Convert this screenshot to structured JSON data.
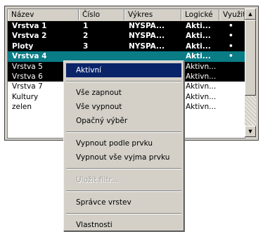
{
  "columns": [
    "Název",
    "Číslo",
    "Výkres",
    "Logické",
    "Využito"
  ],
  "rows": [
    {
      "name": "Vrstva 1",
      "num": "1",
      "draw": "NYSPA...",
      "log": "Akti...",
      "use": "•",
      "state": "sel",
      "bold": true
    },
    {
      "name": "Vrstva 2",
      "num": "2",
      "draw": "NYSPA...",
      "log": "Akti...",
      "use": "•",
      "state": "sel",
      "bold": true
    },
    {
      "name": "Ploty",
      "num": "3",
      "draw": "NYSPA...",
      "log": "Akti...",
      "use": "•",
      "state": "sel",
      "bold": true
    },
    {
      "name": "Vrstva 4",
      "num": "",
      "draw": "",
      "log": "Akti...",
      "use": "•",
      "state": "focus",
      "bold": true
    },
    {
      "name": "Vrstva 5",
      "num": "",
      "draw": "",
      "log": "Aktivn...",
      "use": "",
      "state": "dark",
      "bold": false
    },
    {
      "name": "Vrstva 6",
      "num": "",
      "draw": "",
      "log": "Aktivn...",
      "use": "",
      "state": "dark",
      "bold": false
    },
    {
      "name": "Vrstva 7",
      "num": "",
      "draw": "",
      "log": "Aktivn...",
      "use": "",
      "state": "",
      "bold": false
    },
    {
      "name": "Kultury",
      "num": "",
      "draw": "",
      "log": "Aktivn...",
      "use": "",
      "state": "",
      "bold": false
    },
    {
      "name": "zelen",
      "num": "",
      "draw": "",
      "log": "Aktivn...",
      "use": "",
      "state": "",
      "bold": false
    }
  ],
  "menu": {
    "items": [
      {
        "label": "Aktivní",
        "type": "item",
        "highlight": true,
        "disabled": false
      },
      {
        "type": "separator"
      },
      {
        "label": "Vše zapnout",
        "type": "item",
        "highlight": false,
        "disabled": false
      },
      {
        "label": "Vše vypnout",
        "type": "item",
        "highlight": false,
        "disabled": false
      },
      {
        "label": "Opačný výběr",
        "type": "item",
        "highlight": false,
        "disabled": false
      },
      {
        "type": "separator"
      },
      {
        "label": "Vypnout podle prvku",
        "type": "item",
        "highlight": false,
        "disabled": false
      },
      {
        "label": "Vypnout vše vyjma prvku",
        "type": "item",
        "highlight": false,
        "disabled": false
      },
      {
        "type": "separator"
      },
      {
        "label": "Uložit filtr...",
        "type": "item",
        "highlight": false,
        "disabled": true
      },
      {
        "type": "separator"
      },
      {
        "label": "Správce vrstev",
        "type": "item",
        "highlight": false,
        "disabled": false
      },
      {
        "type": "separator"
      },
      {
        "label": "Vlastnosti",
        "type": "item",
        "highlight": false,
        "disabled": false
      }
    ]
  },
  "scrollbar": {
    "up_arrow": "triangle-up",
    "down_arrow": "triangle-down"
  }
}
